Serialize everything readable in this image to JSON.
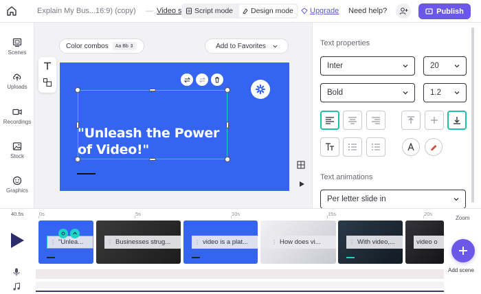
{
  "topbar": {
    "doc_title": "Explain My Bus...16:9)  (copy)",
    "separator": "—",
    "doc_link": "Video s",
    "script_mode": "Script mode",
    "design_mode": "Design mode",
    "upgrade": "Upgrade",
    "help": "Need help?",
    "publish": "Publish"
  },
  "leftnav": {
    "items": [
      {
        "label": "Scenes",
        "icon": "scenes-icon"
      },
      {
        "label": "Uploads",
        "icon": "upload-icon"
      },
      {
        "label": "Recordings",
        "icon": "video-camera-icon"
      },
      {
        "label": "Stock",
        "icon": "image-icon"
      },
      {
        "label": "Graphics",
        "icon": "smiley-icon"
      }
    ]
  },
  "canvas": {
    "color_combos": "Color combos",
    "aa_chip": "Aa Bb",
    "favorites": "Add to Favorites",
    "slide_text": "\"Unleash the Power of Video!\"",
    "slide_bg": "#3564f0"
  },
  "properties": {
    "title": "Text properties",
    "font": "Inter",
    "size": "20",
    "weight": "Bold",
    "line_height": "1.2",
    "animations_title": "Text animations",
    "animation": "Per letter slide in"
  },
  "timeline": {
    "duration": "40.5s",
    "ticks": [
      "0s",
      "5s",
      "10s",
      "15s",
      "20s"
    ],
    "zoom": "Zoom",
    "add_scene": "Add scene",
    "scenes": [
      {
        "label": "\"Unlea...",
        "bg": "#3564f0"
      },
      {
        "label": "Businesses strug...",
        "bg": "#2b2b2b"
      },
      {
        "label": "video is a plat...",
        "bg": "#3564f0"
      },
      {
        "label": "How does vi...",
        "bg": "#d9d9dd"
      },
      {
        "label": "With video,...",
        "bg": "#1f2a35"
      },
      {
        "label": "video o",
        "bg": "#222228"
      }
    ]
  },
  "colors": {
    "accent": "#6b57e8",
    "selection": "#1fd3c6"
  }
}
